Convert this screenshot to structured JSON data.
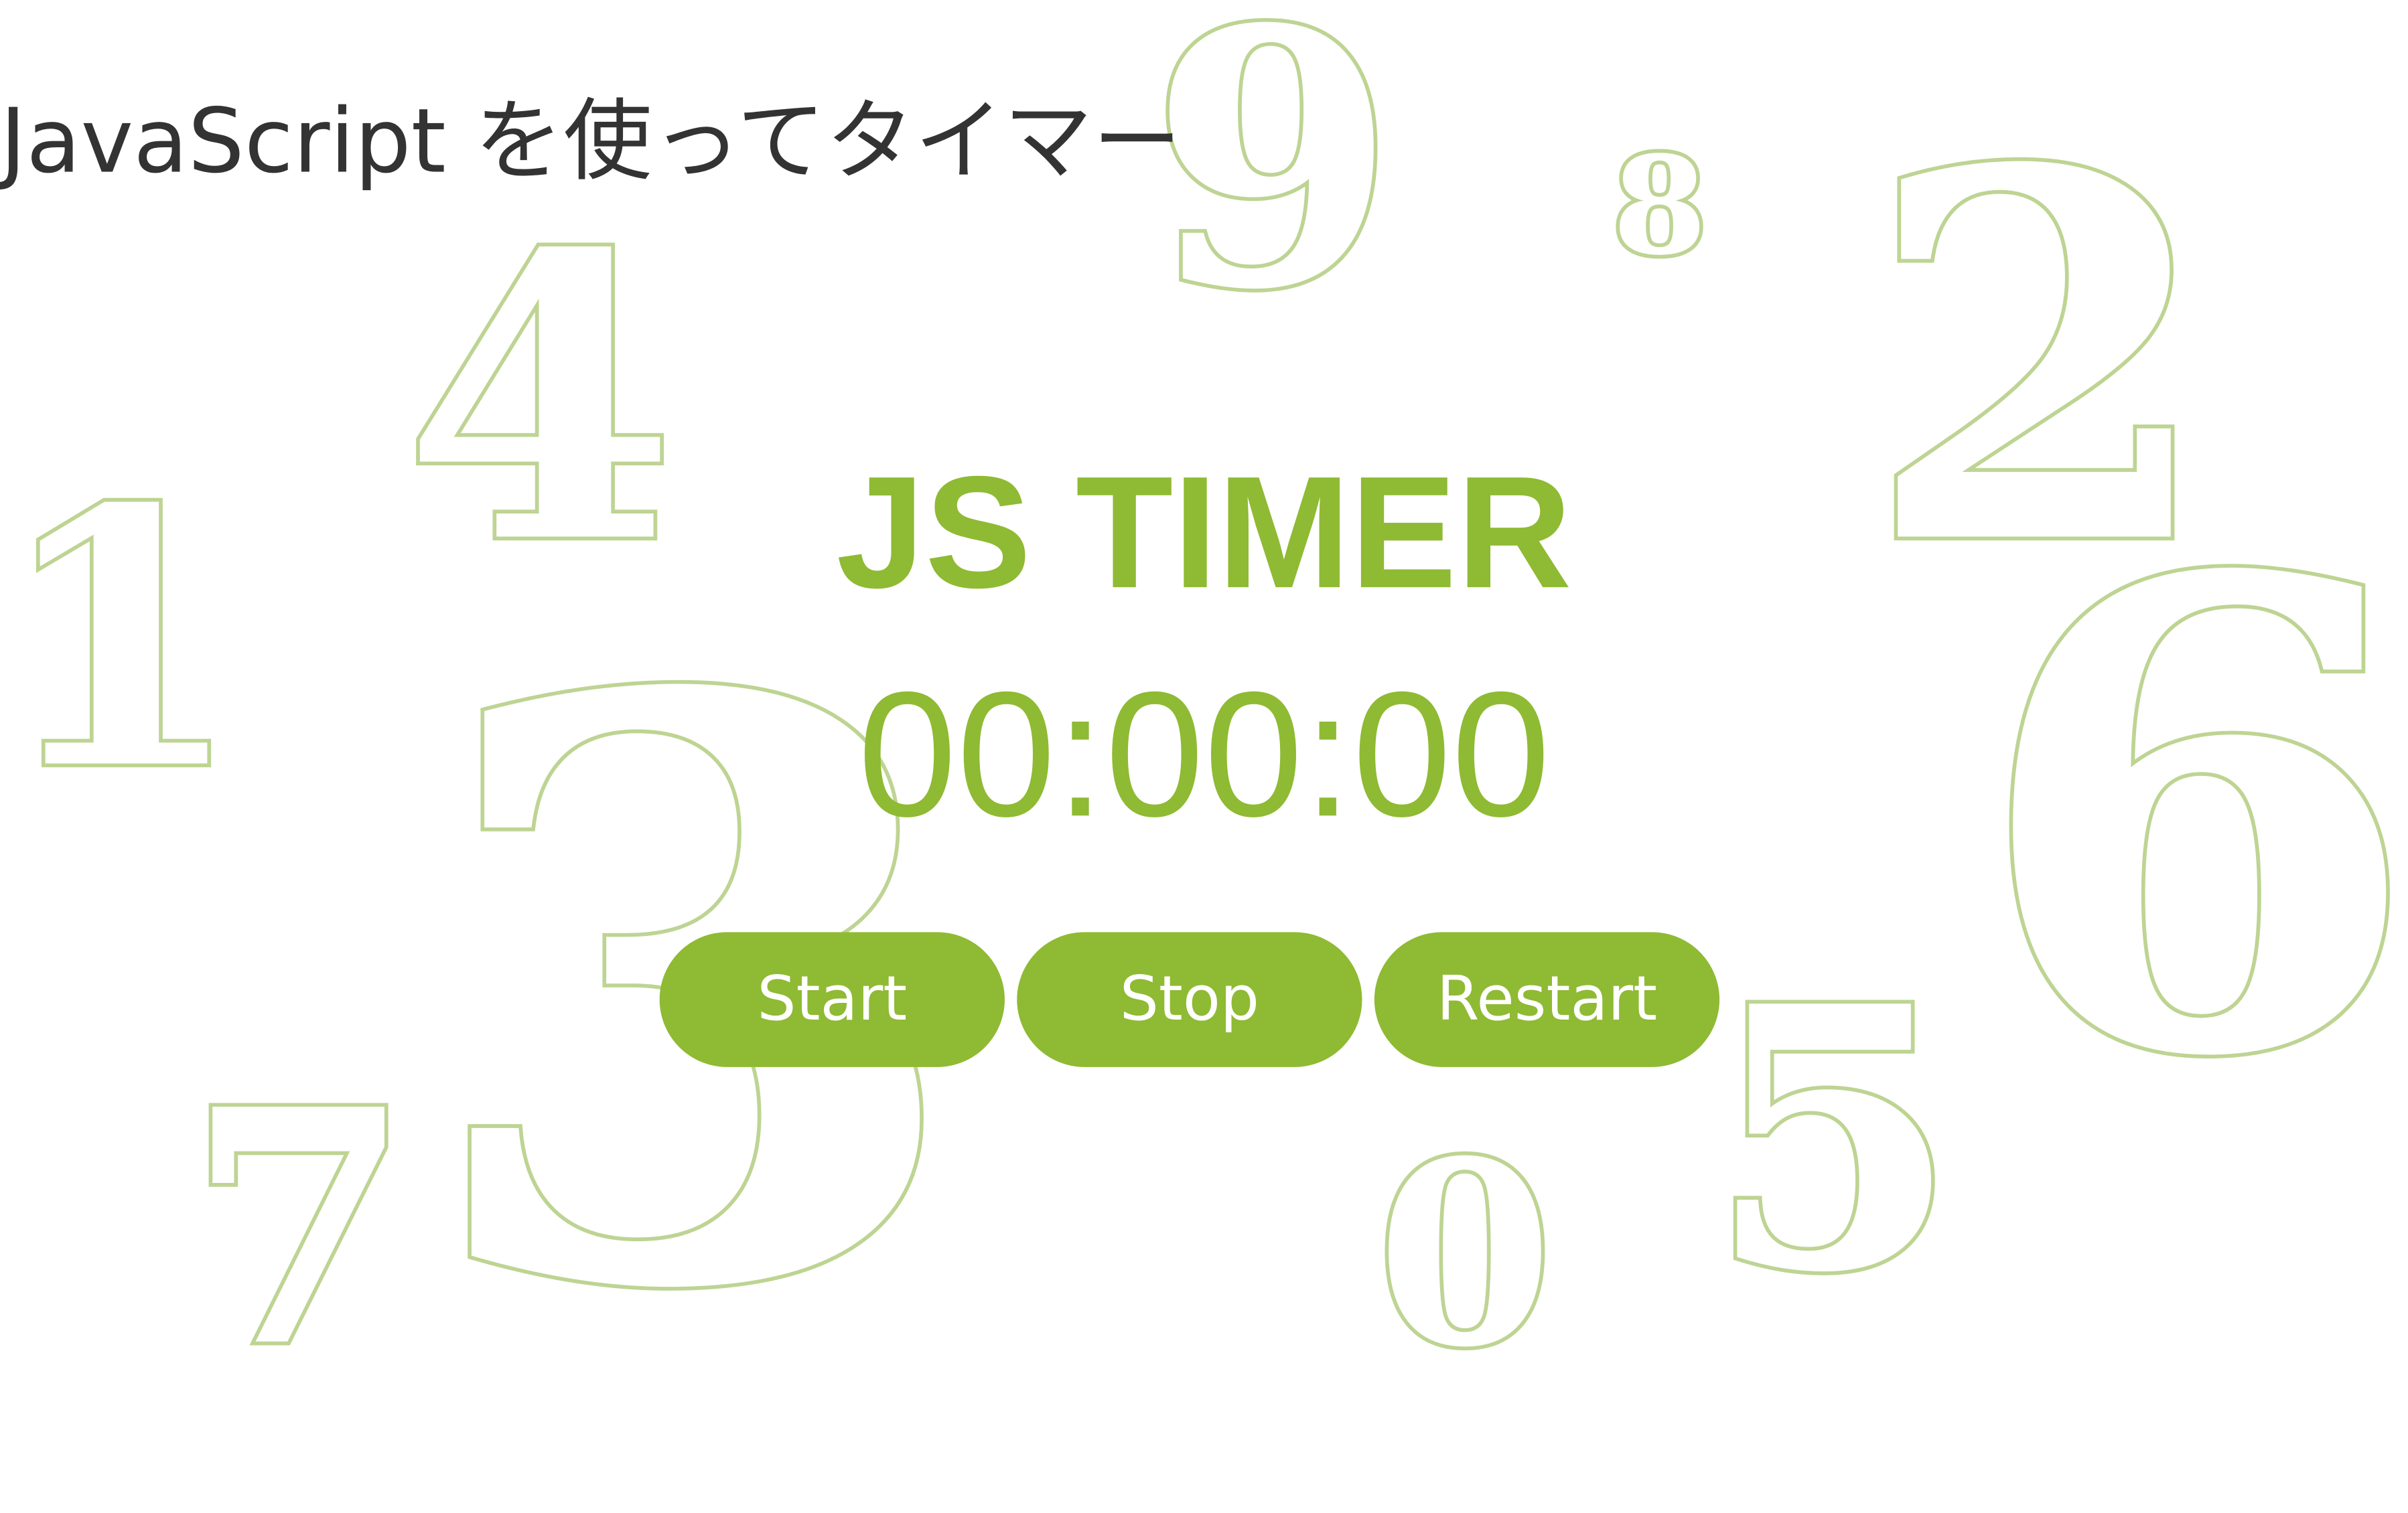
{
  "page": {
    "heading": "JavaScript を使ってタイマー"
  },
  "decorative_digits": [
    "9",
    "8",
    "4",
    "2",
    "1",
    "3",
    "6",
    "7",
    "0",
    "5"
  ],
  "timer": {
    "title": "JS TIMER",
    "display": "00:00:00"
  },
  "controls": {
    "start_label": "Start",
    "stop_label": "Stop",
    "restart_label": "Restart"
  },
  "colors": {
    "accent": "#8fba33",
    "digit_outline": "#bed493",
    "heading_text": "#333333",
    "button_text": "#ffffff",
    "background": "#ffffff"
  }
}
